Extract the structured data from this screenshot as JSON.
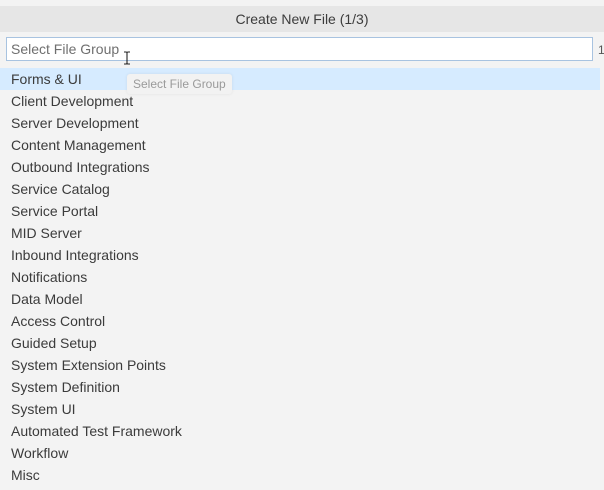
{
  "title": "Create New File (1/3)",
  "search": {
    "placeholder": "Select File Group",
    "value": ""
  },
  "tooltip": "Select File Group",
  "right_glyph": "1",
  "items": [
    {
      "label": "Forms & UI",
      "selected": true
    },
    {
      "label": "Client Development"
    },
    {
      "label": "Server Development"
    },
    {
      "label": "Content Management"
    },
    {
      "label": "Outbound Integrations"
    },
    {
      "label": "Service Catalog"
    },
    {
      "label": "Service Portal"
    },
    {
      "label": "MID Server"
    },
    {
      "label": "Inbound Integrations"
    },
    {
      "label": "Notifications"
    },
    {
      "label": "Data Model"
    },
    {
      "label": "Access Control"
    },
    {
      "label": "Guided Setup"
    },
    {
      "label": "System Extension Points"
    },
    {
      "label": "System Definition"
    },
    {
      "label": "System UI"
    },
    {
      "label": "Automated Test Framework"
    },
    {
      "label": "Workflow"
    },
    {
      "label": "Misc"
    }
  ],
  "colors": {
    "selected_bg": "#d6ebff",
    "input_border": "#a8c3e0",
    "panel_bg": "#f3f3f3"
  }
}
